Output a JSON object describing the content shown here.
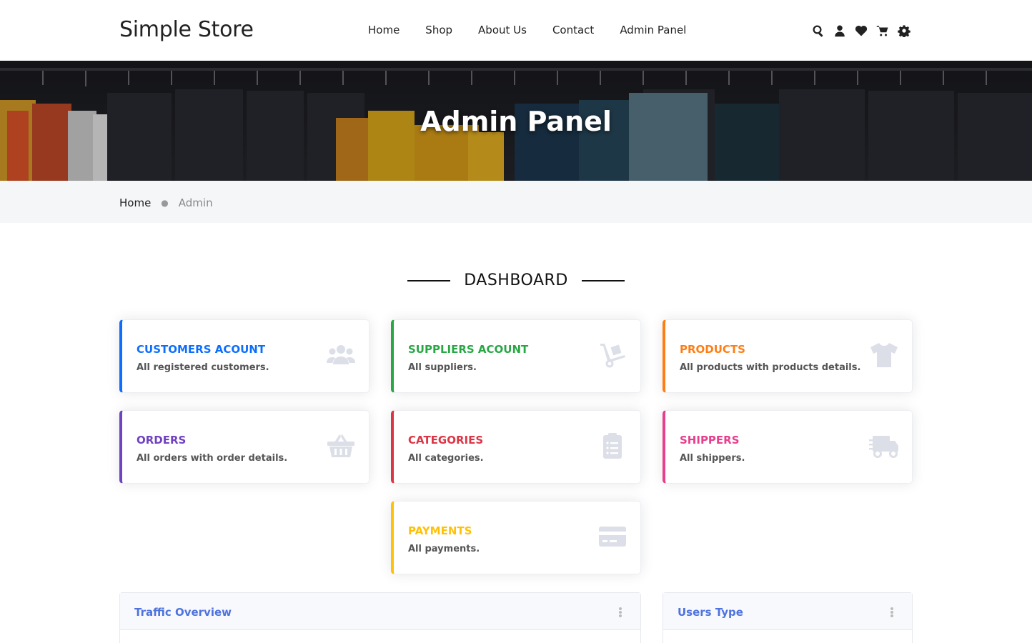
{
  "header": {
    "brand": "Simple Store",
    "nav": [
      "Home",
      "Shop",
      "About Us",
      "Contact",
      "Admin Panel"
    ],
    "icons": [
      "search-icon",
      "user-icon",
      "heart-icon",
      "cart-icon",
      "gear-icon"
    ]
  },
  "hero": {
    "title": "Admin Panel"
  },
  "breadcrumb": {
    "home": "Home",
    "current": "Admin"
  },
  "dashboard": {
    "heading": "DASHBOARD",
    "cards": [
      {
        "title": "CUSTOMERS ACOUNT",
        "desc": "All registered customers.",
        "color": "#0d6efd",
        "icon": "users-icon"
      },
      {
        "title": "SUPPLIERS ACOUNT",
        "desc": "All suppliers.",
        "color": "#28a745",
        "icon": "dolly-icon"
      },
      {
        "title": "PRODUCTS",
        "desc": "All products with products details.",
        "color": "#fd7e14",
        "icon": "tshirt-icon"
      },
      {
        "title": "ORDERS",
        "desc": "All orders with order details.",
        "color": "#6f42c1",
        "icon": "basket-icon"
      },
      {
        "title": "CATEGORIES",
        "desc": "All categories.",
        "color": "#dc3545",
        "icon": "clipboard-list-icon"
      },
      {
        "title": "SHIPPERS",
        "desc": "All shippers.",
        "color": "#e83e8c",
        "icon": "truck-icon"
      },
      {
        "title": "PAYMENTS",
        "desc": "All payments.",
        "color": "#ffc107",
        "icon": "credit-card-icon"
      }
    ]
  },
  "panels": [
    {
      "title": "Traffic Overview"
    },
    {
      "title": "Users Type"
    }
  ]
}
